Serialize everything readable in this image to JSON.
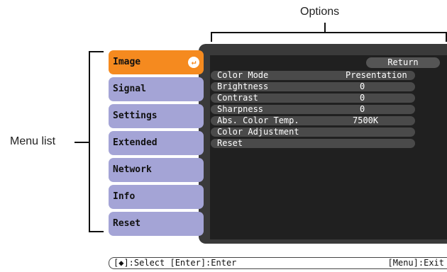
{
  "callouts": {
    "options": "Options",
    "menu_list": "Menu list"
  },
  "menu": {
    "items": [
      {
        "label": "Image",
        "active": true
      },
      {
        "label": "Signal",
        "active": false
      },
      {
        "label": "Settings",
        "active": false
      },
      {
        "label": "Extended",
        "active": false
      },
      {
        "label": "Network",
        "active": false
      },
      {
        "label": "Info",
        "active": false
      },
      {
        "label": "Reset",
        "active": false
      }
    ],
    "active_icon": "enter-icon"
  },
  "options": {
    "return_label": "Return",
    "rows": [
      {
        "label": "Color Mode",
        "value": "Presentation"
      },
      {
        "label": "Brightness",
        "value": "0"
      },
      {
        "label": "Contrast",
        "value": "0"
      },
      {
        "label": "Sharpness",
        "value": "0"
      },
      {
        "label": "Abs. Color Temp.",
        "value": "7500K"
      },
      {
        "label": "Color Adjustment",
        "value": ""
      },
      {
        "label": "Reset",
        "value": ""
      }
    ]
  },
  "status": {
    "left": "[◆]:Select [Enter]:Enter",
    "right": "[Menu]:Exit"
  },
  "colors": {
    "active_item": "#f58a1f",
    "menu_item": "#a4a4d6",
    "osd_background": "#202020"
  }
}
